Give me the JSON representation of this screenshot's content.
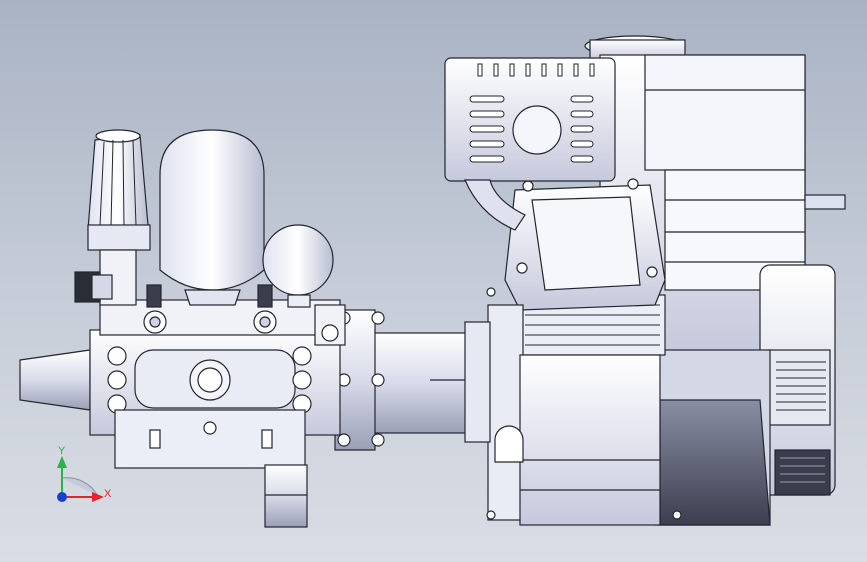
{
  "viewport": {
    "background_top": "#a9b3c4",
    "background_bottom": "#d9dde5"
  },
  "model": {
    "description_name": "pump-engine-assembly",
    "body_color": "#eef0f8",
    "shade_color": "#c9cde0",
    "dark_color": "#4a4e60",
    "line_color": "#23262f"
  },
  "triad": {
    "x_label": "X",
    "y_label": "Y",
    "x_color": "#e0242a",
    "y_color": "#2bb24c",
    "z_color": "#1d3fcf"
  }
}
